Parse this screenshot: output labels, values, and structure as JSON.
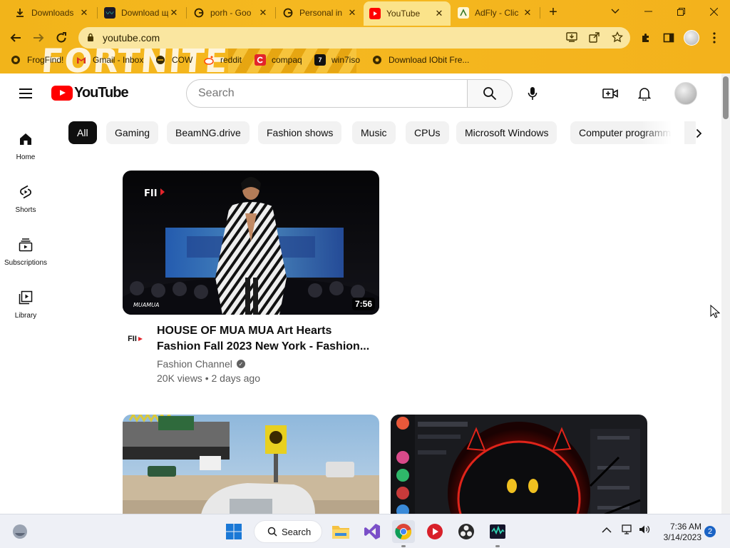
{
  "browser": {
    "tabs": [
      {
        "title": "Downloads",
        "icon": "download-icon"
      },
      {
        "title": "Download щ",
        "icon": "iobit-icon"
      },
      {
        "title": "porh - Goo",
        "icon": "google-icon"
      },
      {
        "title": "Personal in",
        "icon": "google-icon"
      },
      {
        "title": "YouTube",
        "icon": "youtube-icon"
      },
      {
        "title": "AdFly - Clic",
        "icon": "adfly-icon"
      }
    ],
    "active_tab": 4,
    "new_tab_label": "+",
    "url": "youtube.com",
    "bookmarks": [
      {
        "label": "FrogFind!",
        "icon": "frog-icon"
      },
      {
        "label": "Gmail - Inbox",
        "icon": "gmail-icon"
      },
      {
        "label": "COW",
        "icon": "cow-icon"
      },
      {
        "label": "reddit",
        "icon": "reddit-icon"
      },
      {
        "label": "compaq",
        "icon": "compaq-icon"
      },
      {
        "label": "win7iso",
        "icon": "win7iso-icon"
      },
      {
        "label": "Download IObit Fre...",
        "icon": "iobit-icon"
      }
    ],
    "theme_art_text": "FORTNITE",
    "theme_color": "#f3b41c"
  },
  "youtube": {
    "logo_text": "YouTube",
    "search_placeholder": "Search",
    "sidebar": [
      {
        "label": "Home",
        "icon": "home-icon"
      },
      {
        "label": "Shorts",
        "icon": "shorts-icon"
      },
      {
        "label": "Subscriptions",
        "icon": "subscriptions-icon"
      },
      {
        "label": "Library",
        "icon": "library-icon"
      }
    ],
    "chips": [
      "All",
      "Gaming",
      "BeamNG.drive",
      "Fashion shows",
      "Music",
      "CPUs",
      "Microsoft Windows",
      "Computer programm"
    ],
    "selected_chip": "All",
    "videos": [
      {
        "title": "HOUSE OF MUA MUA Art Hearts Fashion Fall 2023 New York - Fashion...",
        "channel": "Fashion Channel",
        "verified": true,
        "views": "20K views",
        "age": "2 days ago",
        "duration": "7:56",
        "channel_avatar_text": "FII",
        "thumb_brand_text": "FII",
        "thumb_watermark_text": "MUAMUA"
      },
      {
        "title": "",
        "channel": "",
        "views": "",
        "age": "",
        "duration": ""
      },
      {
        "title": "",
        "channel": "",
        "views": "",
        "age": "",
        "duration": ""
      }
    ],
    "brand_red": "#ff0000"
  },
  "taskbar": {
    "search_label": "Search",
    "time": "7:36 AM",
    "date": "3/14/2023",
    "notification_count": "2",
    "apps": [
      "widgets-icon",
      "windows-start-icon",
      "file-explorer-icon",
      "visual-studio-icon",
      "chrome-icon",
      "media-app-icon",
      "obs-icon",
      "iobit-app-icon"
    ]
  }
}
